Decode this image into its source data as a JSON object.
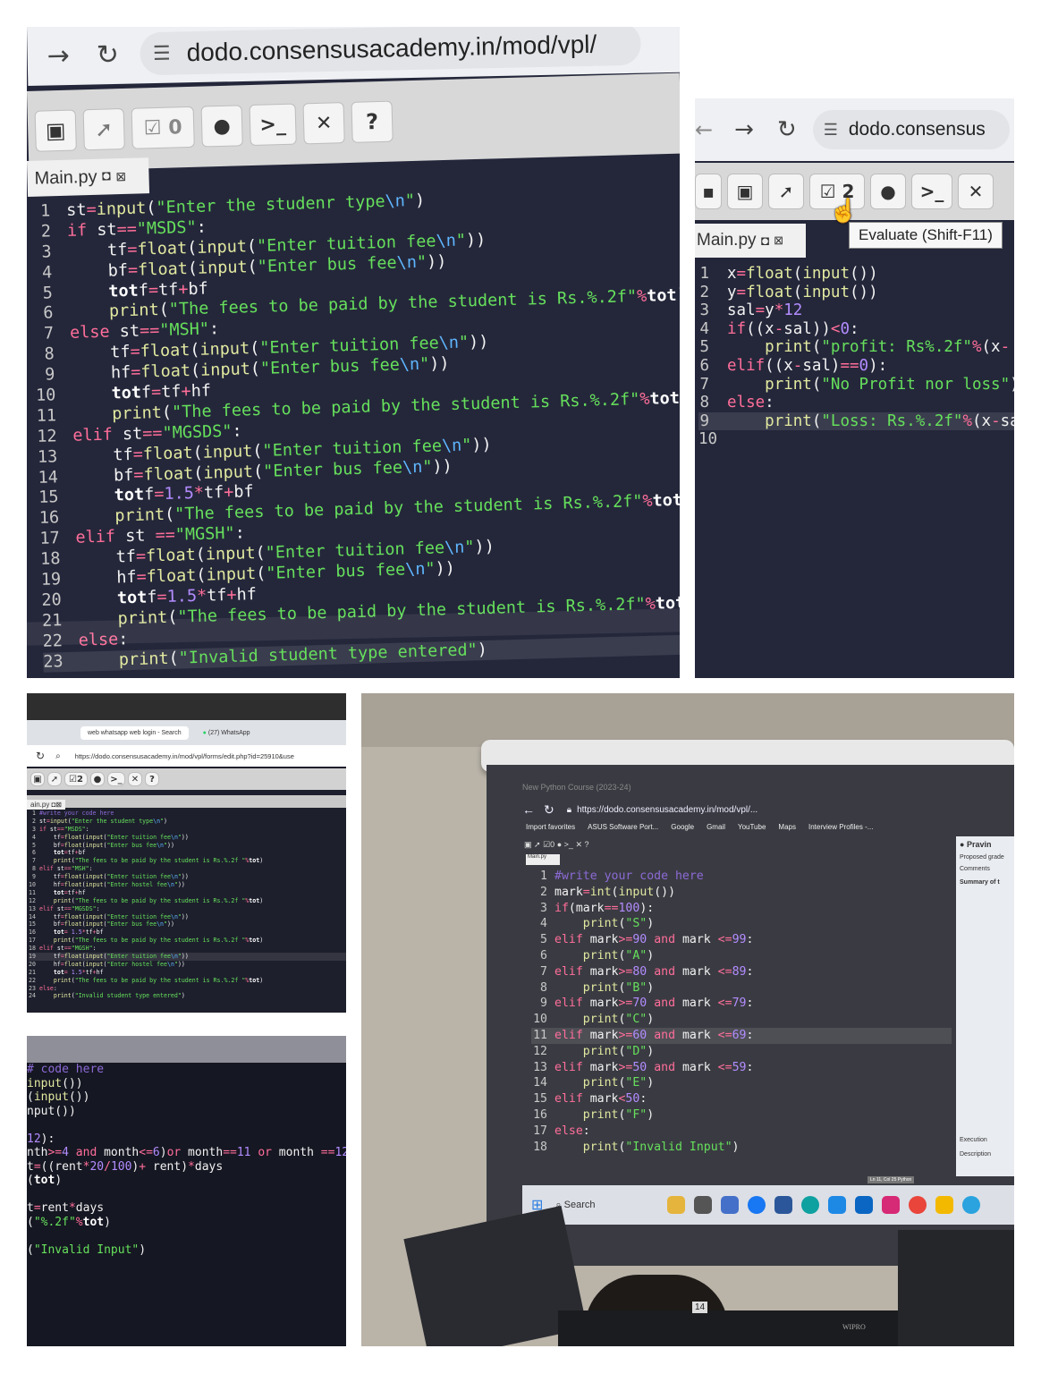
{
  "photo1": {
    "url": "dodo.consensusacademy.in/mod/vpl/",
    "eval_count": "0",
    "file_tab": "Main.py",
    "lines": [
      "st=input(\"Enter the studenr type\\n\")",
      "if st==\"MSDS\":",
      "    tf=float(input(\"Enter tuition fee\\n\"))",
      "    bf=float(input(\"Enter bus fee\\n\"))",
      "    totf=tf+bf",
      "    print(\"The fees to be paid by the student is Rs.%.2f\"%tot)",
      "else st==\"MSH\":",
      "    tf=float(input(\"Enter tuition fee\\n\"))",
      "    hf=float(input(\"Enter bus fee\\n\"))",
      "    totf=tf+hf",
      "    print(\"The fees to be paid by the student is Rs.%.2f\"%tot)",
      "elif st==\"MGSDS\":",
      "    tf=float(input(\"Enter tuition fee\\n\"))",
      "    bf=float(input(\"Enter bus fee\\n\"))",
      "    totf=1.5*tf+bf",
      "    print(\"The fees to be paid by the student is Rs.%.2f\"%tot)",
      "elif st ==\"MGSH\":",
      "    tf=float(input(\"Enter tuition fee\\n\"))",
      "    hf=float(input(\"Enter bus fee\\n\"))",
      "    totf=1.5*tf+hf",
      "    print(\"The fees to be paid by the student is Rs.%.2f\"%tot)",
      "else:",
      "    print(\"Invalid student type entered\")"
    ]
  },
  "photo2": {
    "url": "dodo.consensus",
    "eval_count": "2",
    "tooltip": "Evaluate (Shift-F11)",
    "file_tab": "Main.py",
    "lines": [
      "x=float(input())",
      "y=float(input())",
      "sal=y*12",
      "if((x-sal))<0:",
      "    print(\"profit: Rs%.2f\"%(x-",
      "elif((x-sal)==0):",
      "    print(\"No Profit nor loss\")",
      "else:",
      "    print(\"Loss: Rs.%.2f\"%(x-sa",
      ""
    ]
  },
  "photo3": {
    "tab1": "web whatsapp web login - Search",
    "tab2": "(27) WhatsApp",
    "url": "https://dodo.consensusacademy.in/mod/vpl/forms/edit.php?id=25910&use",
    "eval_count": "2",
    "file_tab": "ain.py",
    "lines": [
      "#write your code here",
      "st=input(\"Enter the student type\\n\")",
      "if st==\"MSDS\":",
      "    tf=float(input(\"Enter tuition fee\\n\"))",
      "    bf=float(input(\"Enter bus fee\\n\"))",
      "    tot=tf+bf",
      "    print(\"The fees to be paid by the student is Rs.%.2f \"%tot)",
      "elif st==\"MSH\":",
      "    tf=float(input(\"Enter tuition fee\\n\"))",
      "    hf=float(input(\"Enter hostel fee\\n\"))",
      "    tot=tf+hf",
      "    print(\"The fees to be paid by the student is Rs.%.2f \"%tot)",
      "elif st==\"MGSDS\":",
      "    tf=float(input(\"Enter tuition fee\\n\"))",
      "    bf=float(input(\"Enter bus fee\\n\"))",
      "    tot= 1.5*tf+bf",
      "    print(\"The fees to be paid by the student is Rs.%.2f \"%tot)",
      "elif st==\"MGSH\":",
      "    tf=float(input(\"Enter tuition fee\\n\"))",
      "    hf=float(input(\"Enter hostel fee\\n\"))",
      "    tot= 1.5*tf+hf",
      "    print(\"The fees to be paid by the student is Rs.%.2f \"%tot)",
      "else:",
      "    print(\"Invalid student type entered\")"
    ]
  },
  "photo4": {
    "lines": [
      "# code here",
      "input())",
      "(input())",
      "nput())",
      "",
      "12):",
      "nth>=4 and month<=6)or month==11 or month ==12):",
      "t=((rent*20/100)+ rent)*days",
      "(tot)",
      "",
      "t=rent*days",
      "(\"%.2f\"%tot)",
      "",
      "(\"Invalid Input\")"
    ]
  },
  "photo5": {
    "browser_title": "New Python Course (2023-24)",
    "url": "https://dodo.consensusacademy.in/mod/vpl/...",
    "bookmarks": [
      "Import favorites",
      "ASUS Software Port...",
      "Google",
      "Gmail",
      "YouTube",
      "Maps",
      "Interview Profiles -..."
    ],
    "user": "Pravin",
    "side_items": [
      "Proposed grade",
      "Comments",
      "Summary of t",
      "Execution",
      "Description"
    ],
    "eval_count": "0",
    "file_tab": "Main.py",
    "status": "Ln 11, Col 25 Python",
    "search": "Search",
    "monitor_label": "14",
    "brand": "WIPRO",
    "lines": [
      "#write your code here",
      "mark=int(input())",
      "if(mark==100):",
      "    print(\"S\")",
      "elif mark>=90 and mark <=99:",
      "    print(\"A\")",
      "elif mark>=80 and mark <=89:",
      "    print(\"B\")",
      "elif mark>=70 and mark <=79:",
      "    print(\"C\")",
      "elif mark>=60 and mark <=69:",
      "    print(\"D\")",
      "elif mark>=50 and mark <=59:",
      "    print(\"E\")",
      "elif mark<50:",
      "    print(\"F\")",
      "else:",
      "    print(\"Invalid Input\")"
    ]
  }
}
